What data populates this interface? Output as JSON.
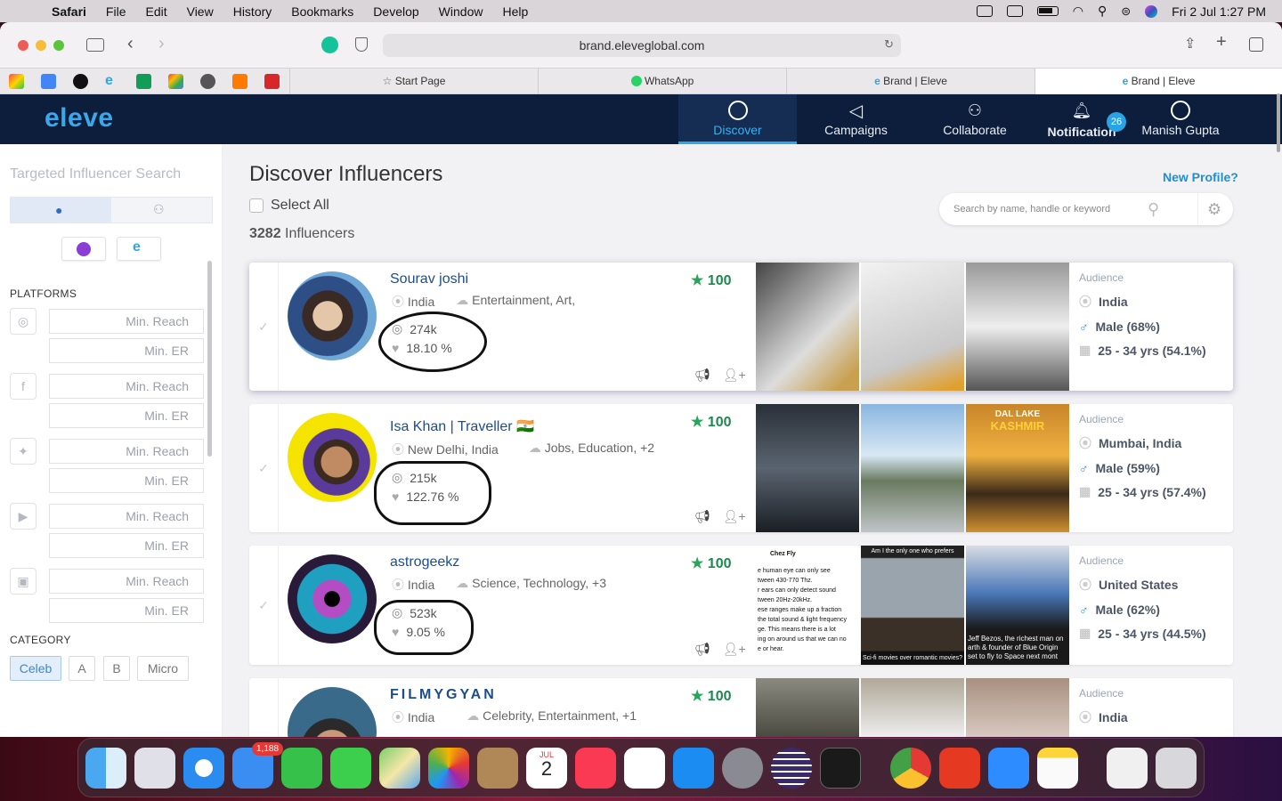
{
  "menubar": {
    "app": "Safari",
    "items": [
      "File",
      "Edit",
      "View",
      "History",
      "Bookmarks",
      "Develop",
      "Window",
      "Help"
    ],
    "clock": "Fri 2 Jul  1:27 PM"
  },
  "browser": {
    "url": "brand.eleveglobal.com",
    "tabs": [
      "Start Page",
      "WhatsApp",
      "Brand | Eleve",
      "Brand | Eleve"
    ]
  },
  "app": {
    "logo": "eleve",
    "nav": [
      "Discover",
      "Campaigns",
      "Collaborate",
      "Notification",
      "Manish Gupta"
    ],
    "notification_count": "26"
  },
  "sidebar": {
    "title": "Targeted Influencer Search",
    "platforms_label": "PLATFORMS",
    "min_reach": "Min. Reach",
    "min_er": "Min. ER",
    "category_label": "CATEGORY",
    "categories": [
      "Celeb",
      "A",
      "B",
      "Micro"
    ]
  },
  "main": {
    "title": "Discover Influencers",
    "new_profile": "New Profile?",
    "select_all": "Select All",
    "count_num": "3282",
    "count_label": "Influencers",
    "search_placeholder": "Search by name, handle or keyword",
    "audience_label": "Audience"
  },
  "influencers": [
    {
      "name": "Sourav joshi",
      "location": "India",
      "categories": "Entertainment, Art,",
      "followers": "274k",
      "er": "18.10 %",
      "score": "100",
      "aud_country": "India",
      "aud_gender": "Male (68%)",
      "aud_age": "25 - 34 yrs (54.1%)"
    },
    {
      "name": "Isa Khan | Traveller 🇮🇳",
      "location": "New Delhi, India",
      "categories": "Jobs, Education, +2",
      "followers": "215k",
      "er": "122.76 %",
      "score": "100",
      "aud_country": "Mumbai, India",
      "aud_gender": "Male (59%)",
      "aud_age": "25 - 34 yrs (57.4%)",
      "thumb_text": [
        "DAL LAKE",
        "KASHMIR"
      ]
    },
    {
      "name": "astrogeekz",
      "location": "India",
      "categories": "Science, Technology, +3",
      "followers": "523k",
      "er": "9.05 %",
      "score": "100",
      "aud_country": "United States",
      "aud_gender": "Male (62%)",
      "aud_age": "25 - 34 yrs (44.5%)",
      "thumb_tweet": [
        "Chez Fly",
        "e human eye can only see",
        "tween 430-770 Thz.",
        "r ears can only detect sound",
        "tween 20Hz-20kHz.",
        "ese ranges make up a fraction",
        "the total sound & light frequency",
        "ge. This means there is a lot",
        "ing on around us that we can no",
        "e or hear."
      ],
      "thumb_meme_top": "Am I the only one who prefers",
      "thumb_meme_bottom": "Sci-fi movies over romantic movies?",
      "thumb_news": [
        "Jeff Bezos, the richest man on",
        "arth & founder of Blue Origin",
        "set to fly to Space next mont"
      ]
    },
    {
      "name": "FILMYGYAN",
      "location": "India",
      "categories": "Celebrity, Entertainment, +1",
      "score": "100",
      "aud_country": "India"
    }
  ],
  "dock": {
    "mail_badge": "1,188",
    "calendar_month": "JUL",
    "calendar_day": "2"
  }
}
